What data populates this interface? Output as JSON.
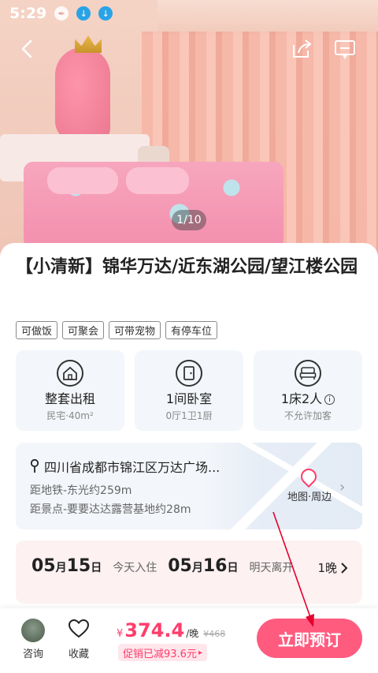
{
  "status_bar": {
    "time": "5:29"
  },
  "gallery": {
    "pager": "1/10"
  },
  "listing": {
    "title": "【小清新】锦华万达/近东湖公园/望江楼公园",
    "tags": [
      "可做饭",
      "可聚会",
      "可带宠物",
      "有停车位"
    ]
  },
  "features": [
    {
      "icon": "house-icon",
      "title": "整套出租",
      "sub": "民宅·40m²"
    },
    {
      "icon": "door-icon",
      "title": "1间卧室",
      "sub": "0厅1卫1厨"
    },
    {
      "icon": "bed-icon",
      "title": "1床2人",
      "sub": "不允许加客"
    }
  ],
  "location": {
    "address": "四川省成都市锦江区万达广场...",
    "dist_metro": "距地铁-东光约259m",
    "dist_scenic": "距景点-要要达达露营基地约28m",
    "map_label": "地图·周边"
  },
  "dates": {
    "checkin_num": "05",
    "checkin_month": "月",
    "checkin_day": "15",
    "checkin_unit": "日",
    "checkin_label": "今天入住",
    "checkout_num": "05",
    "checkout_month": "月",
    "checkout_day": "16",
    "checkout_unit": "日",
    "checkout_label": "明天离开",
    "nights": "1晚"
  },
  "bottom": {
    "consult_label": "咨询",
    "fav_label": "收藏",
    "currency": "¥",
    "price": "374.4",
    "per": "/晚",
    "original": "¥468",
    "promo": "促销已减93.6元",
    "book_label": "立即预订"
  },
  "colors": {
    "accent": "#ff5b7f",
    "price": "#ff3d6b",
    "annotation_arrow": "#e4002b"
  }
}
